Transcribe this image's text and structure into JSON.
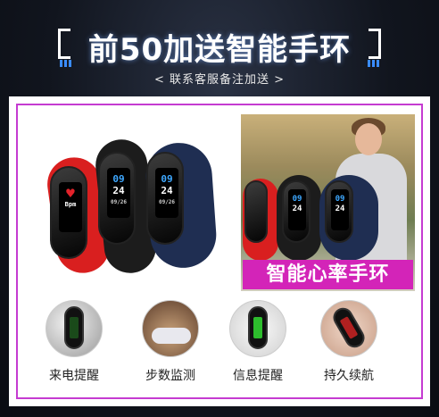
{
  "header": {
    "title": "前50加送智能手环",
    "subtitle": "< 联系客服备注加送 >"
  },
  "product": {
    "band_colors": [
      "#d91f1f",
      "#1c1c1c",
      "#1f2e52"
    ],
    "screens": [
      {
        "icon": "heart-icon",
        "text": "Bpm"
      },
      {
        "time_h": "09",
        "time_m": "24",
        "date": "09/26"
      },
      {
        "time_h": "09",
        "time_m": "24",
        "date": "09/26"
      }
    ]
  },
  "promo": {
    "label": "智能心率手环",
    "label_color": "#d324b8"
  },
  "features": [
    {
      "label": "来电提醒",
      "icon": "phone-call-icon"
    },
    {
      "label": "步数监测",
      "icon": "shoe-steps-icon"
    },
    {
      "label": "信息提醒",
      "icon": "message-icon"
    },
    {
      "label": "持久续航",
      "icon": "battery-icon"
    }
  ],
  "colors": {
    "accent_border": "#c53bd1",
    "background": "#11151e"
  }
}
